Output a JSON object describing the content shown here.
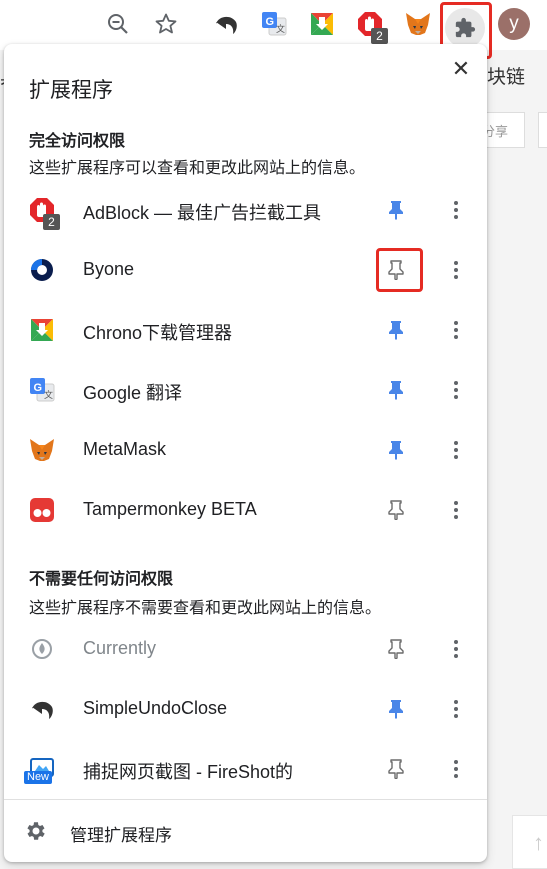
{
  "toolbar": {
    "avatar_letter": "y",
    "adblock_badge": "2"
  },
  "background": {
    "left_text": "具",
    "right_text": "块链",
    "share_label": "分享"
  },
  "panel": {
    "title": "扩展程序",
    "close_glyph": "✕",
    "full_access": {
      "title": "完全访问权限",
      "desc": "这些扩展程序可以查看和更改此网站上的信息。",
      "items": [
        {
          "name": "AdBlock — 最佳广告拦截工具",
          "pinned": true,
          "badge": "2"
        },
        {
          "name": "Byone",
          "pinned": false
        },
        {
          "name": "Chrono下载管理器",
          "pinned": true
        },
        {
          "name": "Google 翻译",
          "pinned": true
        },
        {
          "name": "MetaMask",
          "pinned": true
        },
        {
          "name": "Tampermonkey BETA",
          "pinned": false
        }
      ]
    },
    "no_access": {
      "title": "不需要任何访问权限",
      "desc": "这些扩展程序不需要查看和更改此网站上的信息。",
      "items": [
        {
          "name": "Currently",
          "pinned": false
        },
        {
          "name": "SimpleUndoClose",
          "pinned": true
        },
        {
          "name": "捕捉网页截图 - FireShot的",
          "pinned": false,
          "badge": "New"
        }
      ]
    },
    "footer": {
      "label": "管理扩展程序"
    }
  },
  "colors": {
    "pin_active": "#4a86e8",
    "pin_inactive": "#6b6b6b",
    "highlight": "#e52b23"
  }
}
